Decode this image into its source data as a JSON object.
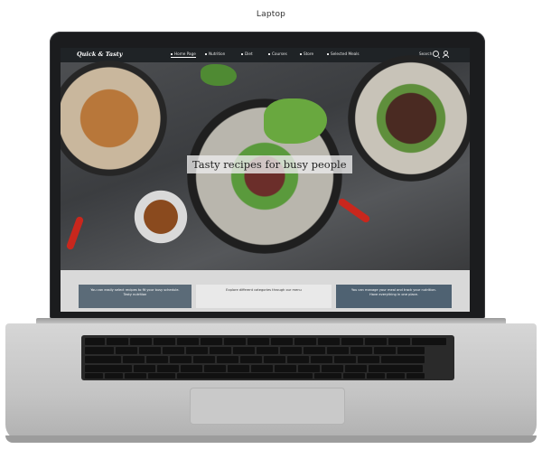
{
  "caption": "Laptop",
  "site": {
    "logo": "Quick & Tasty",
    "nav": [
      {
        "label": "Home Page"
      },
      {
        "label": "Nutrition"
      },
      {
        "label": "Diet"
      },
      {
        "label": "Courses"
      },
      {
        "label": "Store"
      },
      {
        "label": "Selected Meals"
      }
    ],
    "search_label": "Search",
    "hero_title": "Tasty recipes for busy people",
    "cards": [
      {
        "text": "You can easily select recipes to fit your busy schedule.",
        "subtext": "Tasty nutrition"
      },
      {
        "text": "Explore different categories through our menu",
        "subtext": ""
      },
      {
        "text": "You can manage your meal and track your nutrition.",
        "subtext": "Have everything in one place."
      }
    ]
  },
  "colors": {
    "nav_bg": "#1f2326",
    "lid": "#1b1c1e",
    "base": "#c4c4c4"
  }
}
